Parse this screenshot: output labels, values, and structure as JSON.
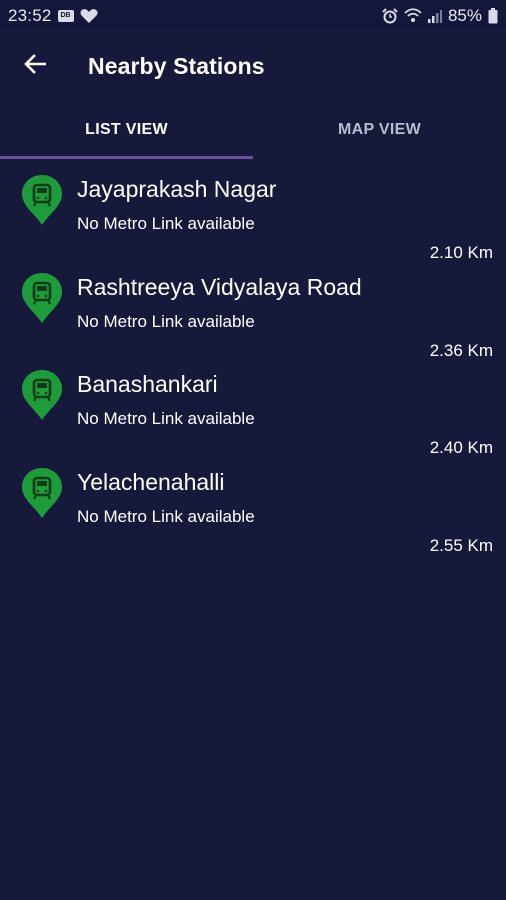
{
  "status_bar": {
    "time": "23:52",
    "battery": "85%"
  },
  "header": {
    "title": "Nearby Stations"
  },
  "tabs": [
    {
      "label": "LIST VIEW",
      "active": true
    },
    {
      "label": "MAP VIEW",
      "active": false
    }
  ],
  "stations": [
    {
      "name": "Jayaprakash Nagar",
      "link_status": "No Metro Link available",
      "distance": "2.10 Km"
    },
    {
      "name": "Rashtreeya Vidyalaya Road",
      "link_status": "No Metro Link available",
      "distance": "2.36 Km"
    },
    {
      "name": "Banashankari",
      "link_status": "No Metro Link available",
      "distance": "2.40 Km"
    },
    {
      "name": "Yelachenahalli",
      "link_status": "No Metro Link available",
      "distance": "2.55 Km"
    }
  ],
  "colors": {
    "background": "#16193a",
    "accent": "#6c4fa3",
    "pin": "#1e9c3a"
  },
  "icons": {
    "back": "arrow-left-icon",
    "station": "metro-pin-icon"
  }
}
